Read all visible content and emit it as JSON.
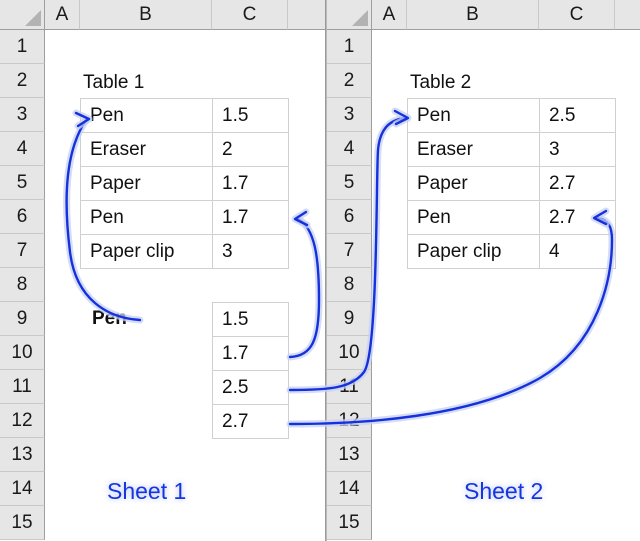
{
  "sheets": [
    {
      "name": "Sheet 1",
      "columns": [
        "A",
        "B",
        "C"
      ],
      "rows": [
        "1",
        "2",
        "3",
        "4",
        "5",
        "6",
        "7",
        "8",
        "9",
        "10",
        "11",
        "12",
        "13",
        "14",
        "15"
      ],
      "table_title": "Table 1",
      "table": {
        "rows": [
          {
            "name": "Pen",
            "value": "1.5"
          },
          {
            "name": "Eraser",
            "value": "2"
          },
          {
            "name": "Paper",
            "value": "1.7"
          },
          {
            "name": "Pen",
            "value": "1.7"
          },
          {
            "name": "Paper clip",
            "value": "3"
          }
        ]
      },
      "lookup_key": "Pen",
      "results": [
        "1.5",
        "1.7",
        "2.5",
        "2.7"
      ]
    },
    {
      "name": "Sheet 2",
      "columns": [
        "A",
        "B",
        "C"
      ],
      "rows": [
        "1",
        "2",
        "3",
        "4",
        "5",
        "6",
        "7",
        "8",
        "9",
        "10",
        "11",
        "12",
        "13",
        "14",
        "15"
      ],
      "table_title": "Table 2",
      "table": {
        "rows": [
          {
            "name": "Pen",
            "value": "2.5"
          },
          {
            "name": "Eraser",
            "value": "3"
          },
          {
            "name": "Paper",
            "value": "2.7"
          },
          {
            "name": "Pen",
            "value": "2.7"
          },
          {
            "name": "Paper clip",
            "value": "4"
          }
        ]
      }
    }
  ],
  "colors": {
    "arrow": "#1530dd",
    "arrow_glow": "#c7d0f2",
    "sheet_label": "#1436e0",
    "header_bg": "#e6e6e6",
    "grid_line": "#d0d0d0"
  },
  "annotations": {
    "arrow_count": 6,
    "description": "Blue curved arrows linking the bold Pen lookup key and the result values to matching Pen rows in Table 1 and Table 2"
  }
}
